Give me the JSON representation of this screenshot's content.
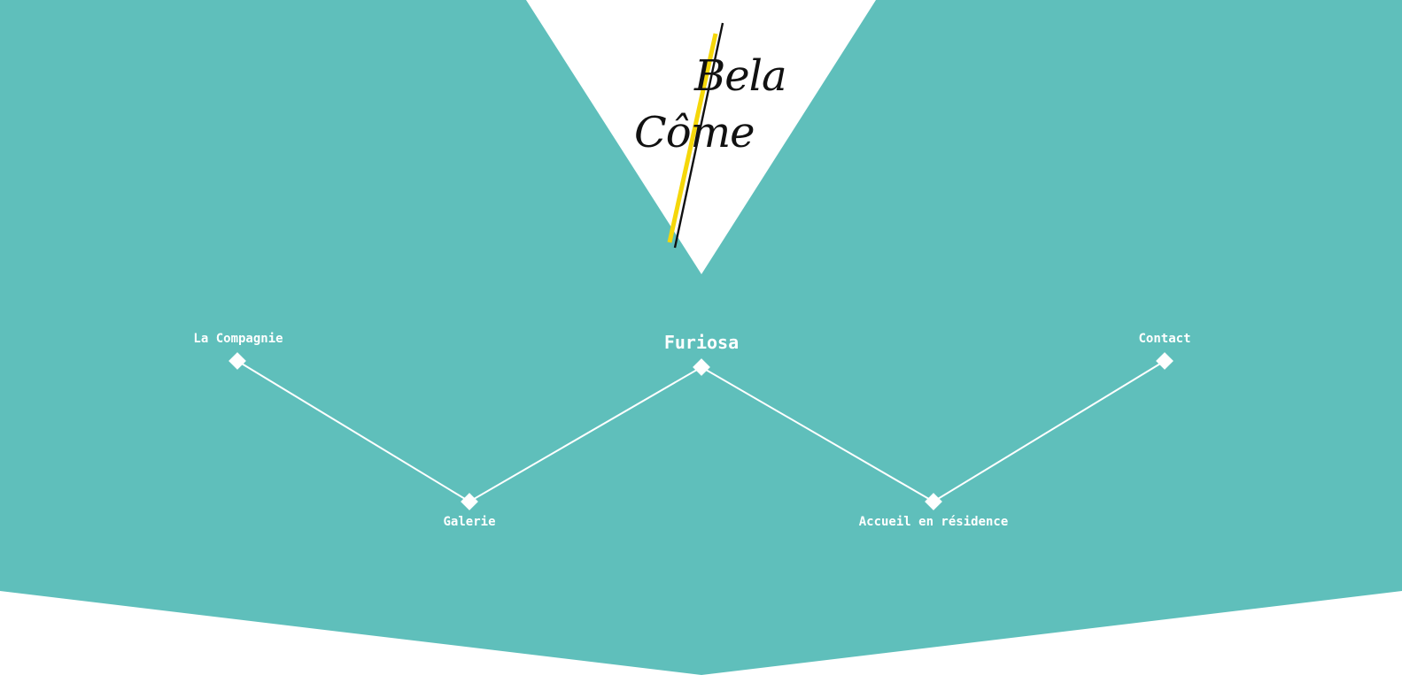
{
  "brand": {
    "logo_line1": "Bela",
    "logo_line2": "Côme"
  },
  "colors": {
    "teal": "#5fbfbb",
    "white": "#ffffff",
    "logo_ink": "#111111",
    "logo_accent": "#f5d70a"
  },
  "nav": {
    "items": [
      {
        "label": "La Compagnie",
        "active": false,
        "row": "top"
      },
      {
        "label": "Galerie",
        "active": false,
        "row": "bottom"
      },
      {
        "label": "Furiosa",
        "active": true,
        "row": "top"
      },
      {
        "label": "Accueil en résidence",
        "active": false,
        "row": "bottom"
      },
      {
        "label": "Contact",
        "active": false,
        "row": "top"
      }
    ]
  }
}
